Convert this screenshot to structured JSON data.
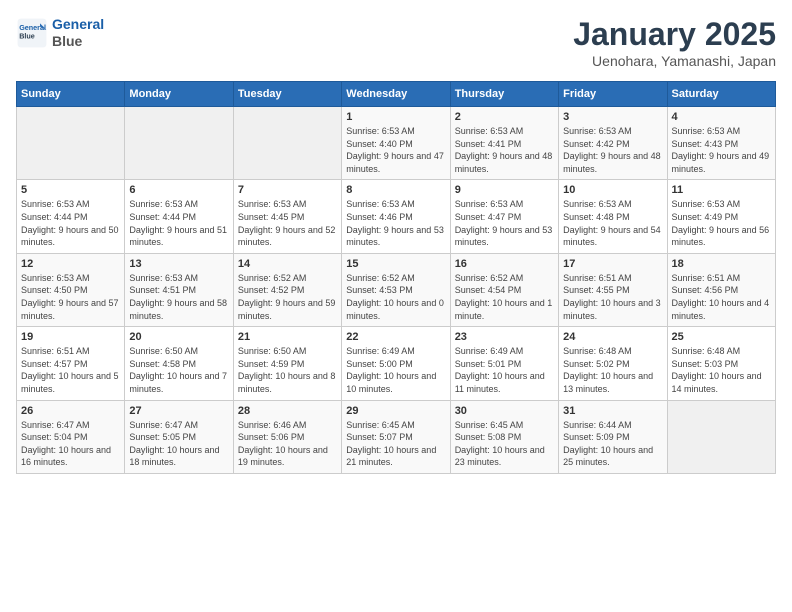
{
  "logo": {
    "line1": "General",
    "line2": "Blue"
  },
  "title": "January 2025",
  "subtitle": "Uenohara, Yamanashi, Japan",
  "days_of_week": [
    "Sunday",
    "Monday",
    "Tuesday",
    "Wednesday",
    "Thursday",
    "Friday",
    "Saturday"
  ],
  "weeks": [
    [
      {
        "day": "",
        "info": ""
      },
      {
        "day": "",
        "info": ""
      },
      {
        "day": "",
        "info": ""
      },
      {
        "day": "1",
        "info": "Sunrise: 6:53 AM\nSunset: 4:40 PM\nDaylight: 9 hours and 47 minutes."
      },
      {
        "day": "2",
        "info": "Sunrise: 6:53 AM\nSunset: 4:41 PM\nDaylight: 9 hours and 48 minutes."
      },
      {
        "day": "3",
        "info": "Sunrise: 6:53 AM\nSunset: 4:42 PM\nDaylight: 9 hours and 48 minutes."
      },
      {
        "day": "4",
        "info": "Sunrise: 6:53 AM\nSunset: 4:43 PM\nDaylight: 9 hours and 49 minutes."
      }
    ],
    [
      {
        "day": "5",
        "info": "Sunrise: 6:53 AM\nSunset: 4:44 PM\nDaylight: 9 hours and 50 minutes."
      },
      {
        "day": "6",
        "info": "Sunrise: 6:53 AM\nSunset: 4:44 PM\nDaylight: 9 hours and 51 minutes."
      },
      {
        "day": "7",
        "info": "Sunrise: 6:53 AM\nSunset: 4:45 PM\nDaylight: 9 hours and 52 minutes."
      },
      {
        "day": "8",
        "info": "Sunrise: 6:53 AM\nSunset: 4:46 PM\nDaylight: 9 hours and 53 minutes."
      },
      {
        "day": "9",
        "info": "Sunrise: 6:53 AM\nSunset: 4:47 PM\nDaylight: 9 hours and 53 minutes."
      },
      {
        "day": "10",
        "info": "Sunrise: 6:53 AM\nSunset: 4:48 PM\nDaylight: 9 hours and 54 minutes."
      },
      {
        "day": "11",
        "info": "Sunrise: 6:53 AM\nSunset: 4:49 PM\nDaylight: 9 hours and 56 minutes."
      }
    ],
    [
      {
        "day": "12",
        "info": "Sunrise: 6:53 AM\nSunset: 4:50 PM\nDaylight: 9 hours and 57 minutes."
      },
      {
        "day": "13",
        "info": "Sunrise: 6:53 AM\nSunset: 4:51 PM\nDaylight: 9 hours and 58 minutes."
      },
      {
        "day": "14",
        "info": "Sunrise: 6:52 AM\nSunset: 4:52 PM\nDaylight: 9 hours and 59 minutes."
      },
      {
        "day": "15",
        "info": "Sunrise: 6:52 AM\nSunset: 4:53 PM\nDaylight: 10 hours and 0 minutes."
      },
      {
        "day": "16",
        "info": "Sunrise: 6:52 AM\nSunset: 4:54 PM\nDaylight: 10 hours and 1 minute."
      },
      {
        "day": "17",
        "info": "Sunrise: 6:51 AM\nSunset: 4:55 PM\nDaylight: 10 hours and 3 minutes."
      },
      {
        "day": "18",
        "info": "Sunrise: 6:51 AM\nSunset: 4:56 PM\nDaylight: 10 hours and 4 minutes."
      }
    ],
    [
      {
        "day": "19",
        "info": "Sunrise: 6:51 AM\nSunset: 4:57 PM\nDaylight: 10 hours and 5 minutes."
      },
      {
        "day": "20",
        "info": "Sunrise: 6:50 AM\nSunset: 4:58 PM\nDaylight: 10 hours and 7 minutes."
      },
      {
        "day": "21",
        "info": "Sunrise: 6:50 AM\nSunset: 4:59 PM\nDaylight: 10 hours and 8 minutes."
      },
      {
        "day": "22",
        "info": "Sunrise: 6:49 AM\nSunset: 5:00 PM\nDaylight: 10 hours and 10 minutes."
      },
      {
        "day": "23",
        "info": "Sunrise: 6:49 AM\nSunset: 5:01 PM\nDaylight: 10 hours and 11 minutes."
      },
      {
        "day": "24",
        "info": "Sunrise: 6:48 AM\nSunset: 5:02 PM\nDaylight: 10 hours and 13 minutes."
      },
      {
        "day": "25",
        "info": "Sunrise: 6:48 AM\nSunset: 5:03 PM\nDaylight: 10 hours and 14 minutes."
      }
    ],
    [
      {
        "day": "26",
        "info": "Sunrise: 6:47 AM\nSunset: 5:04 PM\nDaylight: 10 hours and 16 minutes."
      },
      {
        "day": "27",
        "info": "Sunrise: 6:47 AM\nSunset: 5:05 PM\nDaylight: 10 hours and 18 minutes."
      },
      {
        "day": "28",
        "info": "Sunrise: 6:46 AM\nSunset: 5:06 PM\nDaylight: 10 hours and 19 minutes."
      },
      {
        "day": "29",
        "info": "Sunrise: 6:45 AM\nSunset: 5:07 PM\nDaylight: 10 hours and 21 minutes."
      },
      {
        "day": "30",
        "info": "Sunrise: 6:45 AM\nSunset: 5:08 PM\nDaylight: 10 hours and 23 minutes."
      },
      {
        "day": "31",
        "info": "Sunrise: 6:44 AM\nSunset: 5:09 PM\nDaylight: 10 hours and 25 minutes."
      },
      {
        "day": "",
        "info": ""
      }
    ]
  ]
}
